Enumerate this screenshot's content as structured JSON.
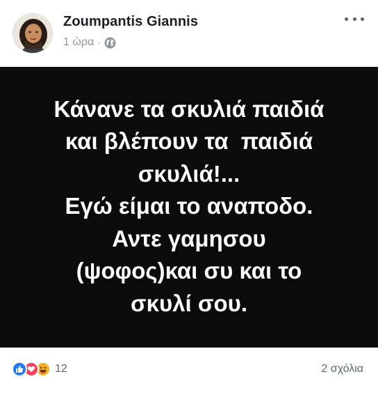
{
  "post": {
    "author": "Zoumpantis Giannis",
    "time": "1 ώρα",
    "separator": "·",
    "privacy_icon": "globe-icon",
    "more_icon": "more-options-icon",
    "image_text_lines": [
      "Κάνανε τα σκυλιά παιδιά",
      "και βλέπουν τα  παιδιά",
      "σκυλιά!...",
      "Εγώ είμαι το αναποδο.",
      "Αντε γαμησου",
      "(ψοφος)και συ και το",
      "σκυλί σου."
    ]
  },
  "footer": {
    "reaction_icons": [
      "like-icon",
      "love-icon",
      "haha-icon"
    ],
    "reaction_count": "12",
    "comments_label": "2 σχόλια"
  },
  "colors": {
    "image_background": "#0b0b0b",
    "image_text": "#ffffff",
    "meta_gray": "#90949c",
    "like_blue": "#2078f4",
    "love_red": "#f33e58",
    "haha_yellow": "#f7b125"
  }
}
